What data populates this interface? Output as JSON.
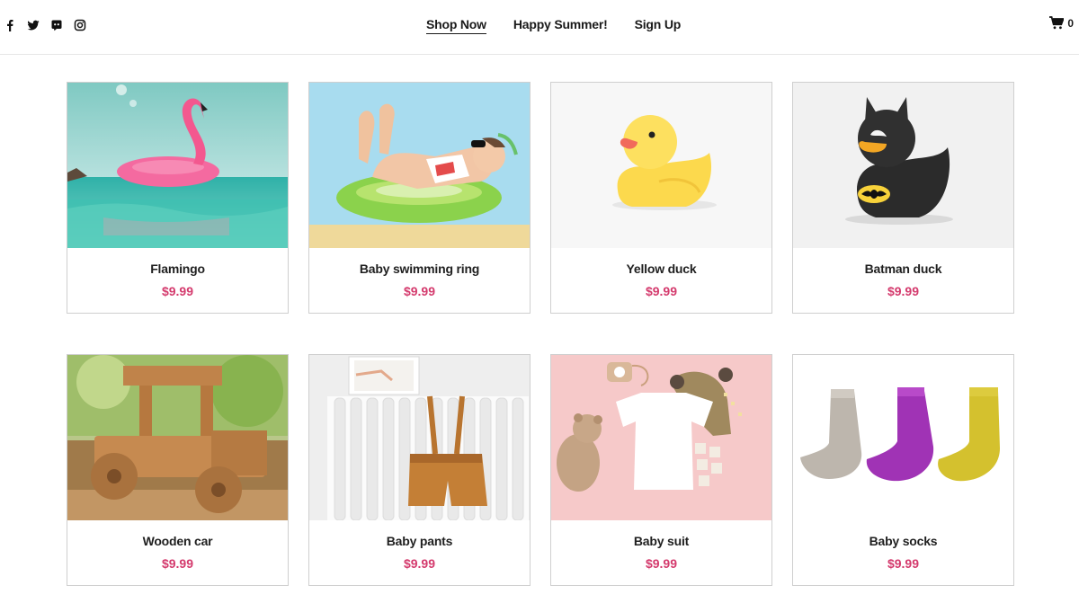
{
  "social": {
    "icons": [
      "facebook-icon",
      "twitter-icon",
      "discord-icon",
      "instagram-icon"
    ]
  },
  "nav": {
    "items": [
      {
        "label": "Shop Now",
        "active": true
      },
      {
        "label": "Happy Summer!",
        "active": false
      },
      {
        "label": "Sign Up",
        "active": false
      }
    ]
  },
  "cart": {
    "icon": "cart-icon",
    "count": "0"
  },
  "colors": {
    "price": "#d43a6d",
    "border": "#cfcfcf",
    "text": "#1a1a1a"
  },
  "products": [
    {
      "name": "Flamingo",
      "price": "$9.99"
    },
    {
      "name": "Baby swimming ring",
      "price": "$9.99"
    },
    {
      "name": "Yellow duck",
      "price": "$9.99"
    },
    {
      "name": "Batman duck",
      "price": "$9.99"
    },
    {
      "name": "Wooden car",
      "price": "$9.99"
    },
    {
      "name": "Baby pants",
      "price": "$9.99"
    },
    {
      "name": "Baby suit",
      "price": "$9.99"
    },
    {
      "name": "Baby socks",
      "price": "$9.99"
    }
  ]
}
